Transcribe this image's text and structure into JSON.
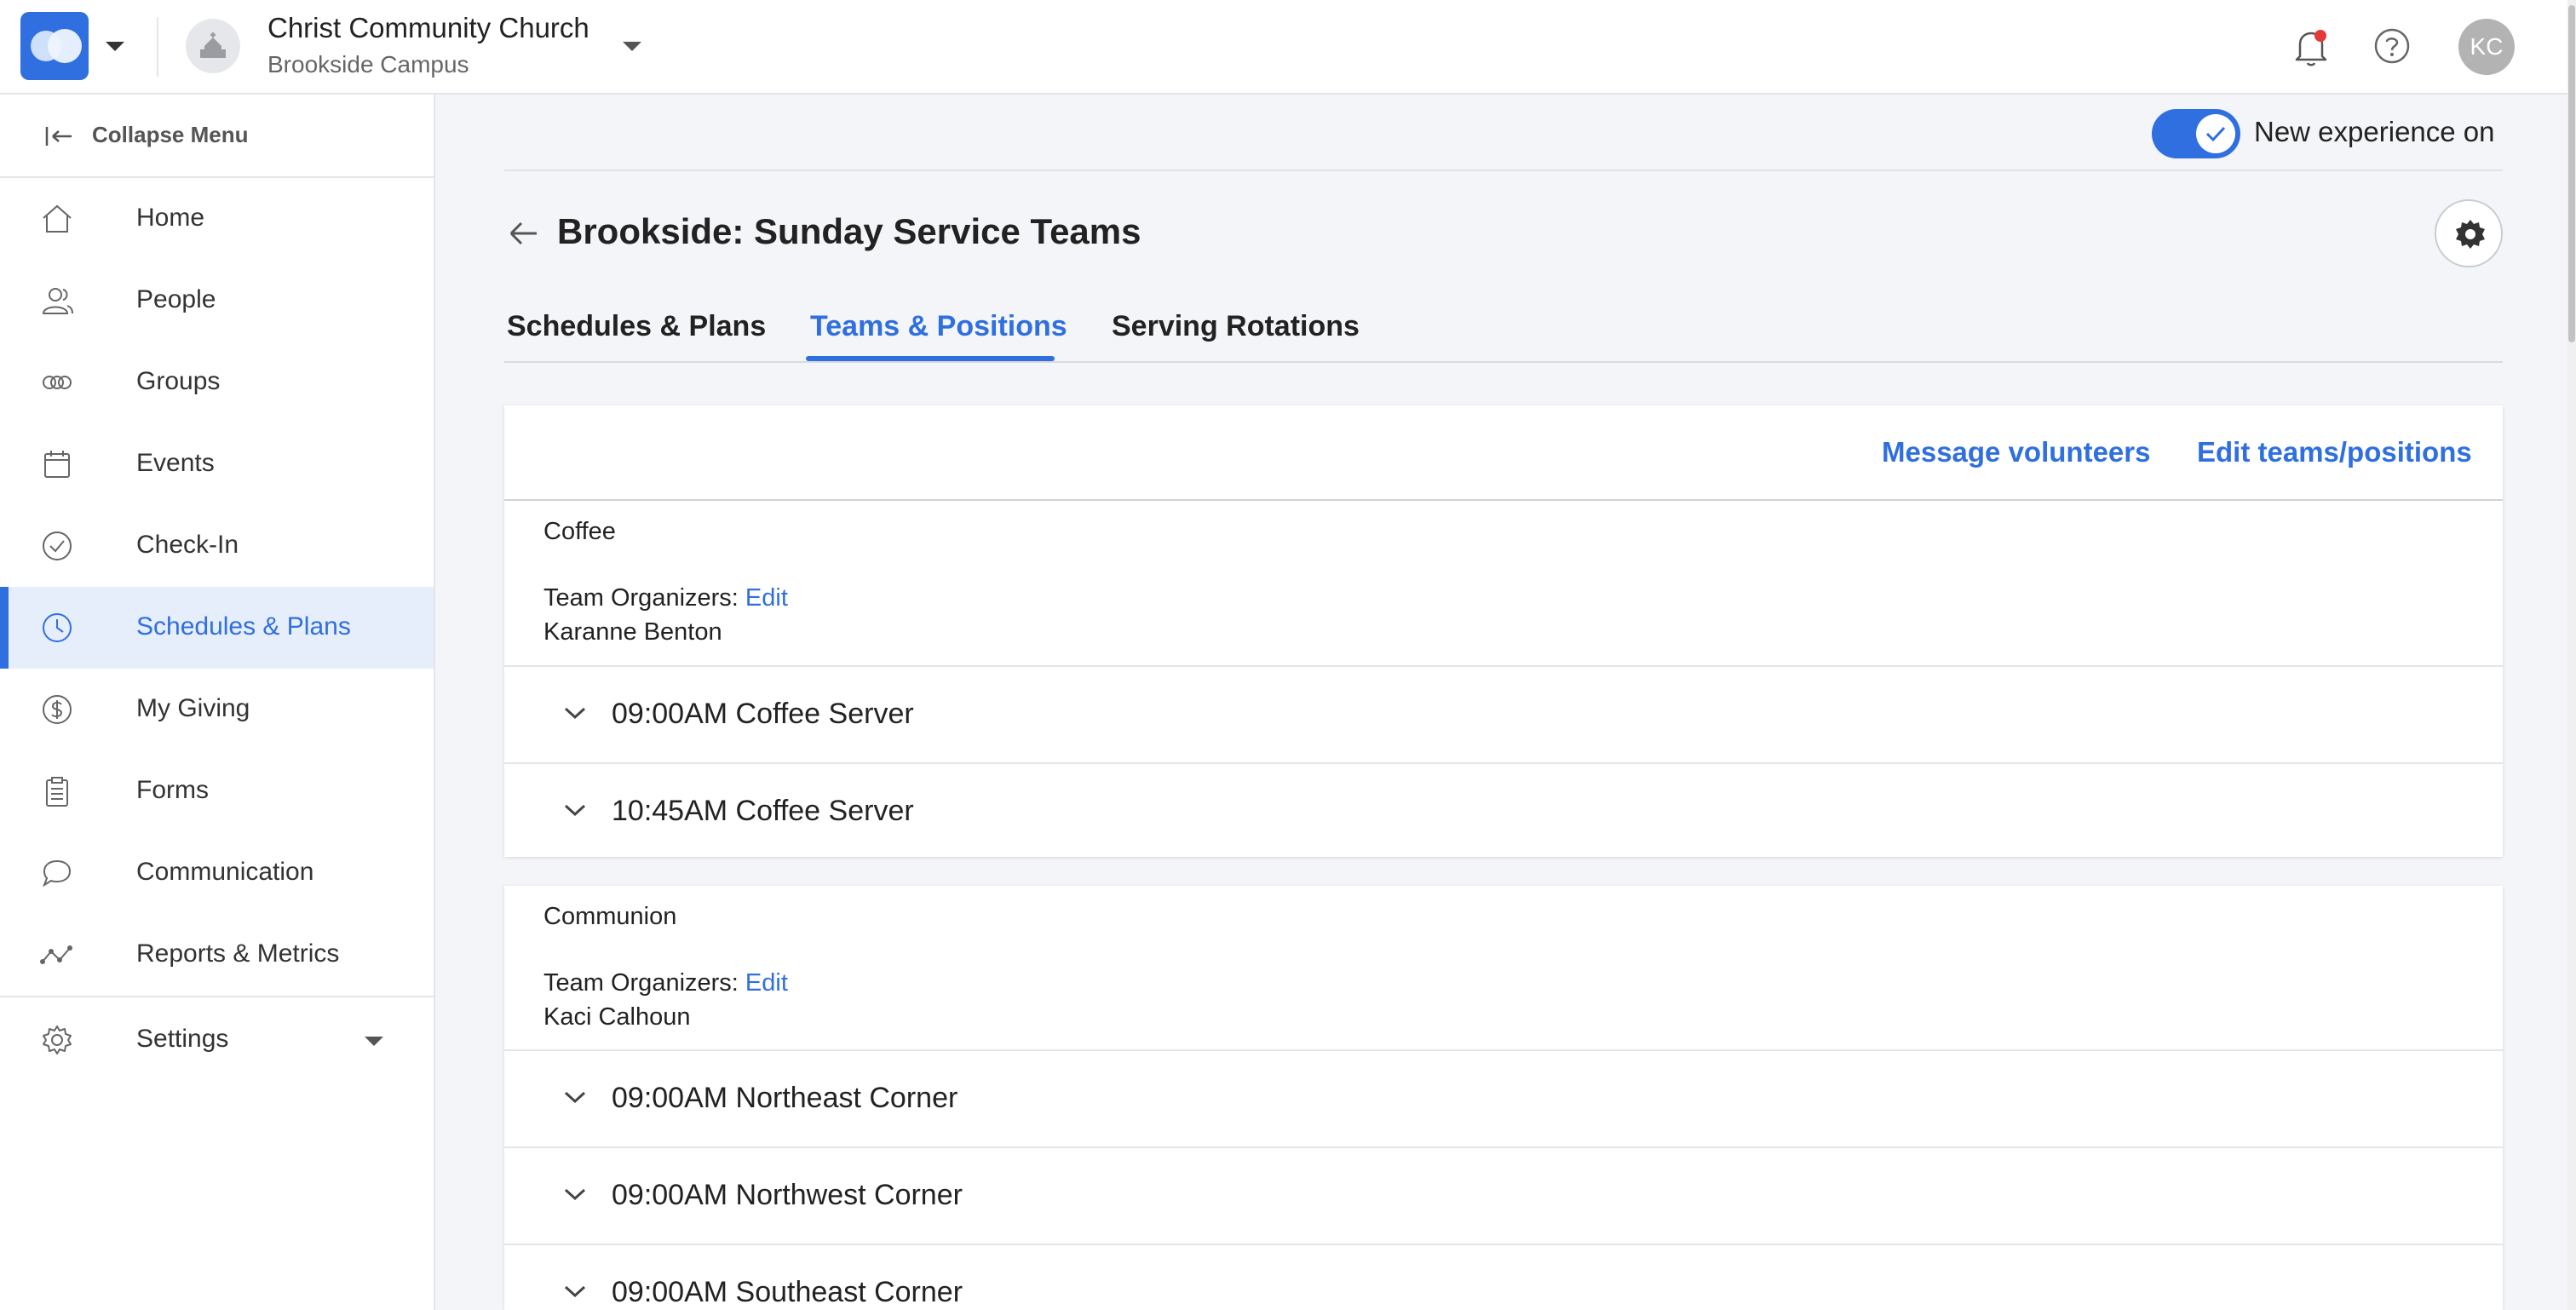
{
  "header": {
    "church_name": "Christ Community Church",
    "campus": "Brookside Campus",
    "user_initials": "KC",
    "icons": [
      "app-logo",
      "chevron-down-icon",
      "church-icon",
      "bell-icon",
      "help-icon"
    ]
  },
  "sidebar": {
    "collapse_label": "Collapse Menu",
    "items": [
      {
        "label": "Home",
        "icon": "home-icon"
      },
      {
        "label": "People",
        "icon": "people-icon"
      },
      {
        "label": "Groups",
        "icon": "groups-icon"
      },
      {
        "label": "Events",
        "icon": "calendar-icon"
      },
      {
        "label": "Check-In",
        "icon": "check-circle-icon"
      },
      {
        "label": "Schedules & Plans",
        "icon": "clock-icon",
        "active": true
      },
      {
        "label": "My Giving",
        "icon": "dollar-icon"
      },
      {
        "label": "Forms",
        "icon": "clipboard-icon"
      },
      {
        "label": "Communication",
        "icon": "chat-icon"
      },
      {
        "label": "Reports & Metrics",
        "icon": "chart-icon"
      }
    ],
    "settings_label": "Settings"
  },
  "main": {
    "toggle_label": "New experience on",
    "toggle_on": true,
    "title": "Brookside: Sunday Service Teams",
    "tabs": [
      {
        "label": "Schedules & Plans"
      },
      {
        "label": "Teams & Positions",
        "active": true
      },
      {
        "label": "Serving Rotations"
      }
    ],
    "actions": {
      "message": "Message volunteers",
      "edit": "Edit teams/positions"
    },
    "organizers_label": "Team Organizers:",
    "edit_label": "Edit",
    "teams": [
      {
        "name": "Coffee",
        "organizer": "Karanne Benton",
        "positions": [
          "09:00AM Coffee Server",
          "10:45AM Coffee Server"
        ]
      },
      {
        "name": "Communion",
        "organizer": "Kaci Calhoun",
        "positions": [
          "09:00AM Northeast Corner",
          "09:00AM Northwest Corner",
          "09:00AM Southeast Corner"
        ]
      }
    ],
    "accent_color": "#2f6fe0"
  }
}
